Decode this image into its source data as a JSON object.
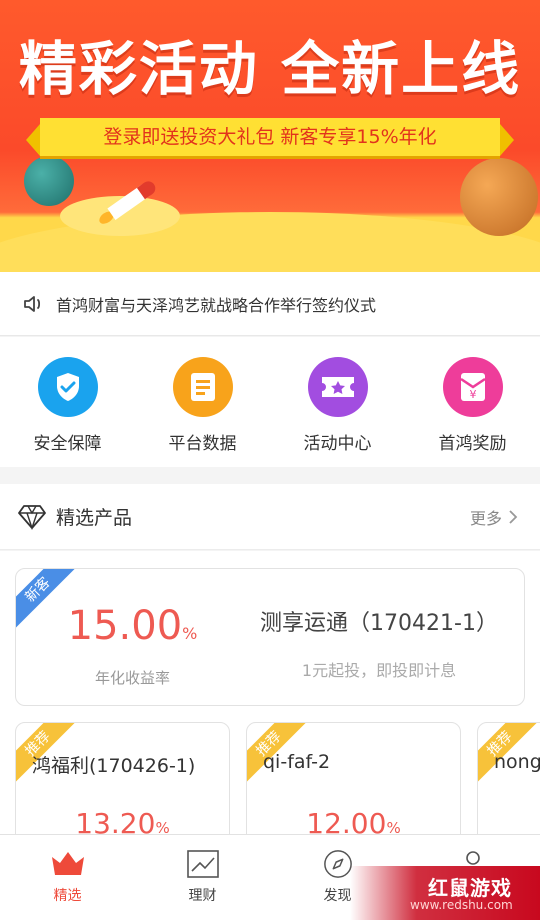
{
  "banner": {
    "title": "精彩活动 全新上线",
    "ribbon": "登录即送投资大礼包 新客专享15%年化"
  },
  "notice": {
    "icon": "speaker-icon",
    "text": "首鸿财富与天泽鸿艺就战略合作举行签约仪式"
  },
  "quick_menu": [
    {
      "label": "安全保障",
      "icon": "shield-check-icon",
      "color": "#1aa3ee"
    },
    {
      "label": "平台数据",
      "icon": "document-icon",
      "color": "#f8a31b"
    },
    {
      "label": "活动中心",
      "icon": "ticket-star-icon",
      "color": "#a24de0"
    },
    {
      "label": "首鸿奖励",
      "icon": "red-envelope-icon",
      "color": "#ee3d9a"
    }
  ],
  "section": {
    "title": "精选产品",
    "more": "更多"
  },
  "featured": {
    "badge": "新客",
    "rate": "15.00",
    "rate_unit": "%",
    "rate_caption": "年化收益率",
    "name": "测享运通（170421-1）",
    "subtitle": "1元起投，即投即计息"
  },
  "cards": [
    {
      "badge": "推荐",
      "name": "鸿福利(170426-1)",
      "rate": "13.20",
      "rate_unit": "%"
    },
    {
      "badge": "推荐",
      "name": "qi-faf-2",
      "rate": "12.00",
      "rate_unit": "%"
    },
    {
      "badge": "推荐",
      "name": "nong",
      "rate": "",
      "rate_unit": ""
    }
  ],
  "tabs": [
    {
      "label": "精选",
      "icon": "crown-icon",
      "active": true
    },
    {
      "label": "理财",
      "icon": "chart-icon",
      "active": false
    },
    {
      "label": "发现",
      "icon": "compass-icon",
      "active": false
    },
    {
      "label": "",
      "icon": "user-icon",
      "active": false
    }
  ],
  "watermark": {
    "brand": "红鼠游戏",
    "url": "www.redshu.com"
  },
  "colors": {
    "accent": "#ee4a3a",
    "rate": "#ee5a52"
  }
}
